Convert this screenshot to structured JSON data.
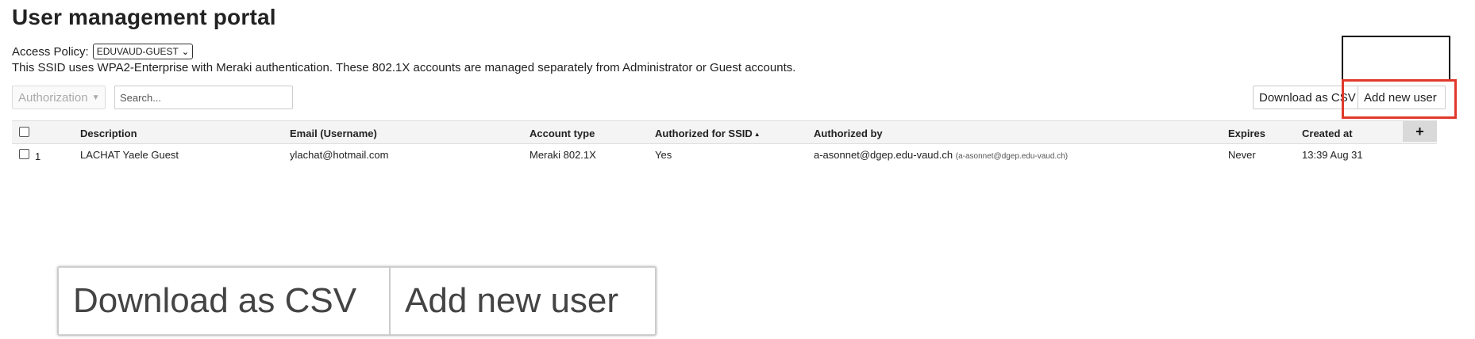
{
  "page": {
    "title": "User management portal"
  },
  "policy": {
    "label": "Access Policy:",
    "selected": "EDUVAUD-GUEST",
    "note": "This SSID uses WPA2-Enterprise with Meraki authentication. These 802.1X accounts are managed separately from Administrator or Guest accounts."
  },
  "toolbar": {
    "authorization_label": "Authorization",
    "search_placeholder": "Search...",
    "download_label": "Download as CSV",
    "add_label": "Add new user"
  },
  "table": {
    "headers": {
      "description": "Description",
      "email": "Email (Username)",
      "account_type": "Account type",
      "authorized_for_ssid": "Authorized for SSID",
      "authorized_by": "Authorized by",
      "expires": "Expires",
      "created_at": "Created at"
    },
    "add_column_label": "+",
    "rows": [
      {
        "index": "1",
        "description": "LACHAT Yaele Guest",
        "email": "ylachat@hotmail.com",
        "account_type": "Meraki 802.1X",
        "authorized_for_ssid": "Yes",
        "authorized_by": "a-asonnet@dgep.edu-vaud.ch",
        "authorized_by_sub": "(a-asonnet@dgep.edu-vaud.ch)",
        "expires": "Never",
        "created_at": "13:39   Aug 31"
      }
    ]
  },
  "zoom": {
    "download_label": "Download as CSV",
    "add_label": "Add new user"
  },
  "colors": {
    "highlight": "#e0392b",
    "header_bg": "#f4f4f4"
  }
}
